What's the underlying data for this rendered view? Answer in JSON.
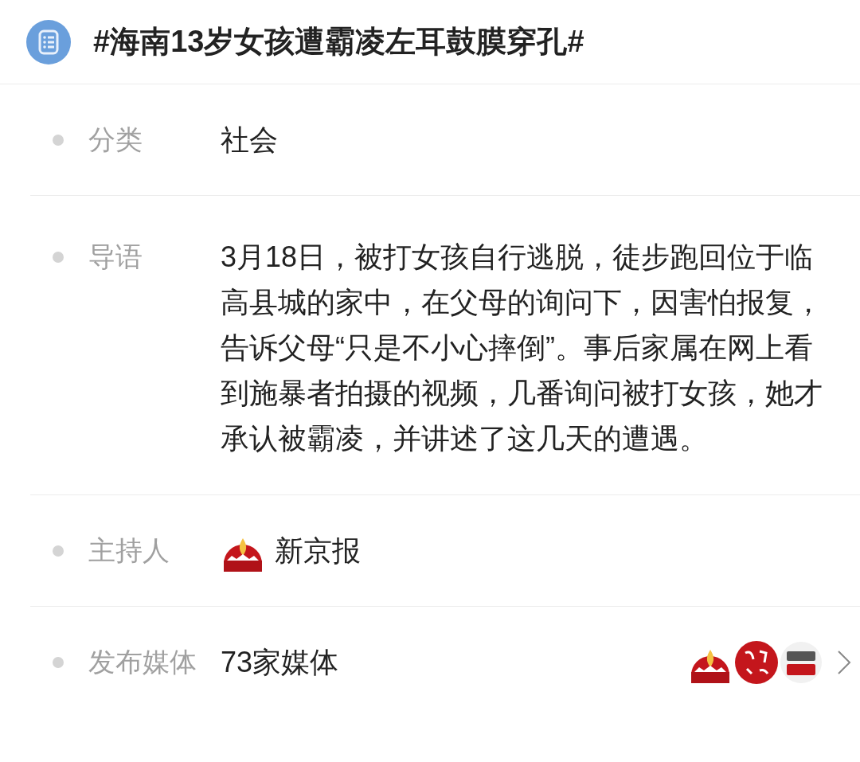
{
  "header": {
    "title": "#海南13岁女孩遭霸凌左耳鼓膜穿孔#"
  },
  "rows": [
    {
      "kind": "text",
      "label": "分类",
      "value": "社会"
    },
    {
      "kind": "text",
      "label": "导语",
      "value": "3月18日，被打女孩自行逃脱，徒步跑回位于临高县城的家中，在父母的询问下，因害怕报复，告诉父母“只是不小心摔倒”。事后家属在网上看到施暴者拍摄的视频，几番询问被打女孩，她才承认被霸凌，并讲述了这几天的遭遇。"
    },
    {
      "kind": "host",
      "label": "主持人",
      "value": "新京报"
    },
    {
      "kind": "media",
      "label": "发布媒体",
      "value": "73家媒体"
    }
  ]
}
